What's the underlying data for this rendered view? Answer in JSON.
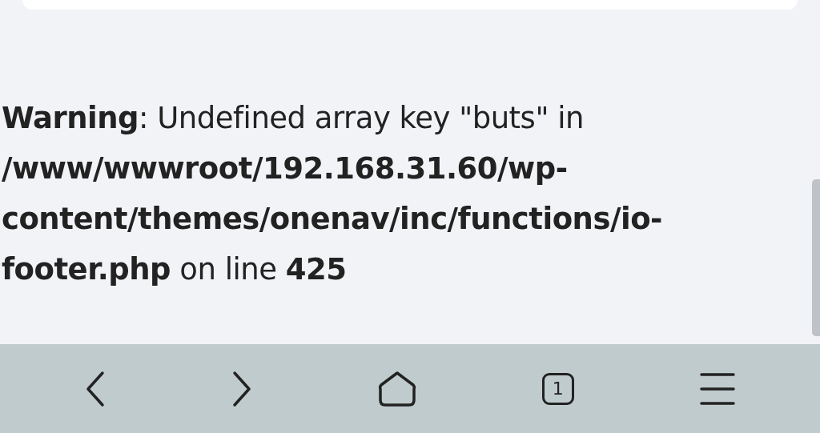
{
  "warning": {
    "message": "**Warning**: Undefined array key \"buts\" in **/www/wwwroot/192.168.31.60/wp-content/themes/onenav/inc/functions/io-footer.php** on line **425**"
  },
  "toolbar": {
    "tab_count": "1"
  }
}
